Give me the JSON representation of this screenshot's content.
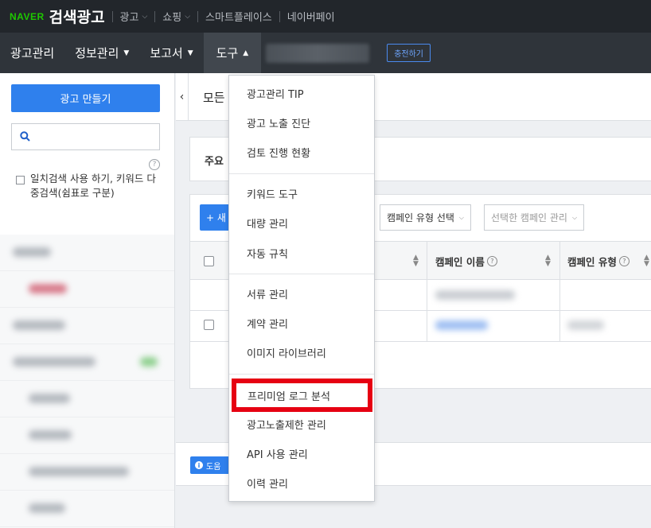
{
  "topbar": {
    "brand_naver": "NAVER",
    "brand_title": "검색광고",
    "links": [
      "광고",
      "쇼핑",
      "스마트플레이스",
      "네이버페이"
    ]
  },
  "mainnav": {
    "items": [
      "광고관리",
      "정보관리",
      "보고서",
      "도구"
    ],
    "charge_button": "충전하기"
  },
  "sidebar": {
    "create_button": "광고 만들기",
    "search_placeholder": "",
    "help": "?",
    "exact_search_label": "일치검색 사용 하기, 키워드 다중검색(쉼표로 구분)"
  },
  "content": {
    "breadcrumb": "모든",
    "notice_label": "주요",
    "table": {
      "new_button": "+ 새",
      "filter_campaign_type": "캠페인 유형 선택",
      "filter_selected_manage": "선택한 캠페인 관리",
      "columns": [
        "캠페인 이름",
        "캠페인 유형"
      ],
      "help": "?"
    },
    "help_button": "도움"
  },
  "dropdown": {
    "groups": [
      [
        "광고관리 TIP",
        "광고 노출 진단",
        "검토 진행 현황"
      ],
      [
        "키워드 도구",
        "대량 관리",
        "자동 규칙"
      ],
      [
        "서류 관리",
        "계약 관리",
        "이미지 라이브러리"
      ],
      [
        "프리미엄 로그 분석",
        "광고노출제한 관리",
        "API 사용 관리",
        "이력 관리"
      ]
    ]
  },
  "colors": {
    "topbar_bg": "#22262b",
    "nav_bg": "#2f343a",
    "accent_blue": "#2f80ed",
    "naver_green": "#1ec800",
    "highlight_red": "#e60012"
  }
}
